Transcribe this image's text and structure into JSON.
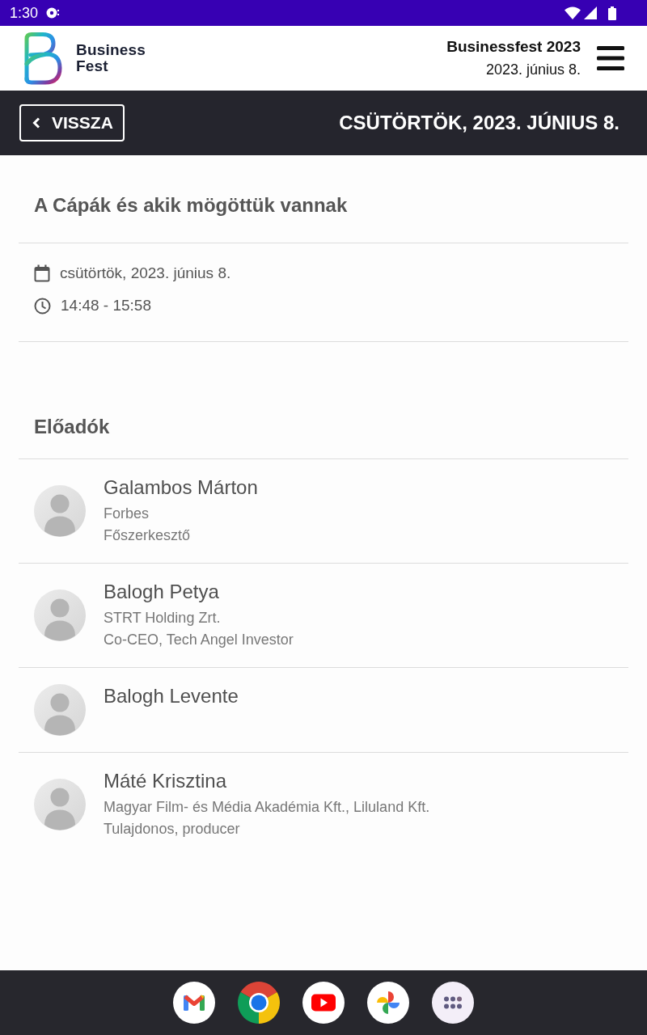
{
  "status_bar": {
    "time": "1:30"
  },
  "header": {
    "brand": "Business Fest",
    "event_title": "Businessfest 2023",
    "event_date": "2023. június 8."
  },
  "toolbar": {
    "back_label": "VISSZA",
    "day_title": "CSÜTÖRTÖK, 2023. JÚNIUS 8."
  },
  "session": {
    "title": "A Cápák és akik mögöttük vannak",
    "details": [
      {
        "kind": "date",
        "text": "csütörtök, 2023. június 8."
      },
      {
        "kind": "time",
        "text": "14:48 - 15:58"
      }
    ]
  },
  "speakers": {
    "heading": "Előadók",
    "items": [
      {
        "name": "Galambos Márton",
        "company": "Forbes",
        "position": "Főszerkesztő"
      },
      {
        "name": "Balogh Petya",
        "company": "STRT Holding Zrt.",
        "position": "Co-CEO, Tech Angel Investor"
      },
      {
        "name": "Balogh Levente"
      },
      {
        "name": "Máté Krisztina",
        "company": "Magyar Film- és Média Akadémia Kft., Liluland Kft.",
        "position": "Tulajdonos, producer"
      }
    ]
  }
}
